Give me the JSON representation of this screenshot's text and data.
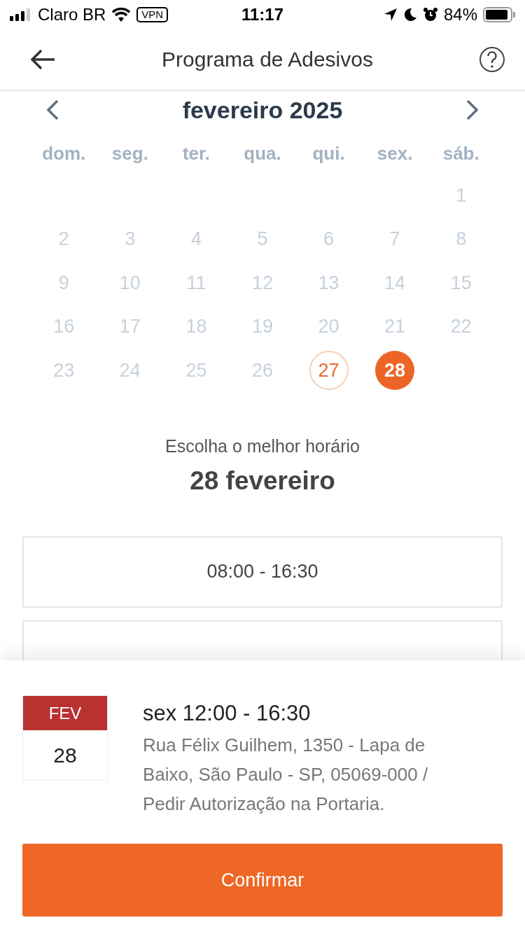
{
  "status_bar": {
    "carrier": "Claro BR",
    "vpn": "VPN",
    "time": "11:17",
    "battery": "84%"
  },
  "nav": {
    "title": "Programa de Adesivos"
  },
  "calendar": {
    "month": "fevereiro 2025",
    "weekdays": [
      "dom.",
      "seg.",
      "ter.",
      "qua.",
      "qui.",
      "sex.",
      "sáb."
    ],
    "weeks": [
      {
        "days": [
          {
            "label": "1",
            "selected": false,
            "today": false
          }
        ]
      },
      {
        "days": [
          {
            "label": "2",
            "selected": false,
            "today": false
          },
          {
            "label": "3",
            "selected": false,
            "today": false
          },
          {
            "label": "4",
            "selected": false,
            "today": false
          },
          {
            "label": "5",
            "selected": false,
            "today": false
          },
          {
            "label": "6",
            "selected": false,
            "today": false
          },
          {
            "label": "7",
            "selected": false,
            "today": false
          },
          {
            "label": "8",
            "selected": false,
            "today": false
          }
        ]
      },
      {
        "days": [
          {
            "label": "9",
            "selected": false,
            "today": false
          },
          {
            "label": "10",
            "selected": false,
            "today": false
          },
          {
            "label": "11",
            "selected": false,
            "today": false
          },
          {
            "label": "12",
            "selected": false,
            "today": false
          },
          {
            "label": "13",
            "selected": false,
            "today": false
          },
          {
            "label": "14",
            "selected": false,
            "today": false
          },
          {
            "label": "15",
            "selected": false,
            "today": false
          }
        ]
      },
      {
        "days": [
          {
            "label": "16",
            "selected": false,
            "today": false
          },
          {
            "label": "17",
            "selected": false,
            "today": false
          },
          {
            "label": "18",
            "selected": false,
            "today": false
          },
          {
            "label": "19",
            "selected": false,
            "today": false
          },
          {
            "label": "20",
            "selected": false,
            "today": false
          },
          {
            "label": "21",
            "selected": false,
            "today": false
          },
          {
            "label": "22",
            "selected": false,
            "today": false
          }
        ]
      },
      {
        "days": [
          {
            "label": "23",
            "selected": false,
            "today": false
          },
          {
            "label": "24",
            "selected": false,
            "today": false
          },
          {
            "label": "25",
            "selected": false,
            "today": false
          },
          {
            "label": "26",
            "selected": false,
            "today": false
          },
          {
            "label": "27",
            "selected": false,
            "today": true
          },
          {
            "label": "28",
            "selected": true,
            "today": false
          }
        ]
      }
    ]
  },
  "schedule": {
    "prompt": "Escolha o melhor horário",
    "date": "28 fevereiro",
    "slots": [
      {
        "label": "08:00 - 16:30"
      }
    ]
  },
  "summary": {
    "month": "FEV",
    "day": "28",
    "time": "sex 12:00 - 16:30",
    "address": "Rua Félix Guilhem, 1350 - Lapa de Baixo, São Paulo - SP, 05069-000 / Pedir Autorização na Portaria."
  },
  "confirm_button": "Confirmar"
}
